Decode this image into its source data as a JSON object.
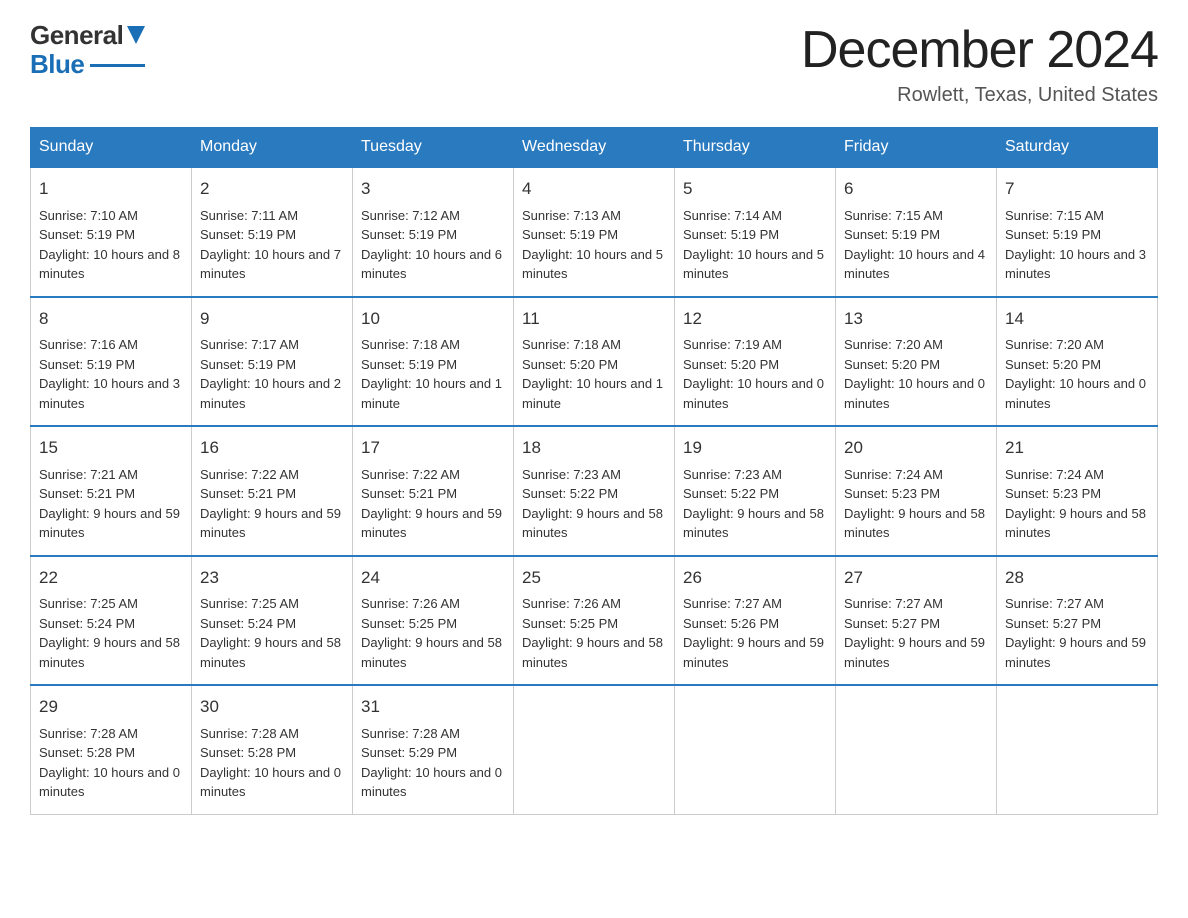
{
  "header": {
    "logo_general": "General",
    "logo_blue": "Blue",
    "month_title": "December 2024",
    "location": "Rowlett, Texas, United States"
  },
  "days_of_week": [
    "Sunday",
    "Monday",
    "Tuesday",
    "Wednesday",
    "Thursday",
    "Friday",
    "Saturday"
  ],
  "weeks": [
    [
      {
        "day": "1",
        "sunrise": "7:10 AM",
        "sunset": "5:19 PM",
        "daylight": "10 hours and 8 minutes."
      },
      {
        "day": "2",
        "sunrise": "7:11 AM",
        "sunset": "5:19 PM",
        "daylight": "10 hours and 7 minutes."
      },
      {
        "day": "3",
        "sunrise": "7:12 AM",
        "sunset": "5:19 PM",
        "daylight": "10 hours and 6 minutes."
      },
      {
        "day": "4",
        "sunrise": "7:13 AM",
        "sunset": "5:19 PM",
        "daylight": "10 hours and 5 minutes."
      },
      {
        "day": "5",
        "sunrise": "7:14 AM",
        "sunset": "5:19 PM",
        "daylight": "10 hours and 5 minutes."
      },
      {
        "day": "6",
        "sunrise": "7:15 AM",
        "sunset": "5:19 PM",
        "daylight": "10 hours and 4 minutes."
      },
      {
        "day": "7",
        "sunrise": "7:15 AM",
        "sunset": "5:19 PM",
        "daylight": "10 hours and 3 minutes."
      }
    ],
    [
      {
        "day": "8",
        "sunrise": "7:16 AM",
        "sunset": "5:19 PM",
        "daylight": "10 hours and 3 minutes."
      },
      {
        "day": "9",
        "sunrise": "7:17 AM",
        "sunset": "5:19 PM",
        "daylight": "10 hours and 2 minutes."
      },
      {
        "day": "10",
        "sunrise": "7:18 AM",
        "sunset": "5:19 PM",
        "daylight": "10 hours and 1 minute."
      },
      {
        "day": "11",
        "sunrise": "7:18 AM",
        "sunset": "5:20 PM",
        "daylight": "10 hours and 1 minute."
      },
      {
        "day": "12",
        "sunrise": "7:19 AM",
        "sunset": "5:20 PM",
        "daylight": "10 hours and 0 minutes."
      },
      {
        "day": "13",
        "sunrise": "7:20 AM",
        "sunset": "5:20 PM",
        "daylight": "10 hours and 0 minutes."
      },
      {
        "day": "14",
        "sunrise": "7:20 AM",
        "sunset": "5:20 PM",
        "daylight": "10 hours and 0 minutes."
      }
    ],
    [
      {
        "day": "15",
        "sunrise": "7:21 AM",
        "sunset": "5:21 PM",
        "daylight": "9 hours and 59 minutes."
      },
      {
        "day": "16",
        "sunrise": "7:22 AM",
        "sunset": "5:21 PM",
        "daylight": "9 hours and 59 minutes."
      },
      {
        "day": "17",
        "sunrise": "7:22 AM",
        "sunset": "5:21 PM",
        "daylight": "9 hours and 59 minutes."
      },
      {
        "day": "18",
        "sunrise": "7:23 AM",
        "sunset": "5:22 PM",
        "daylight": "9 hours and 58 minutes."
      },
      {
        "day": "19",
        "sunrise": "7:23 AM",
        "sunset": "5:22 PM",
        "daylight": "9 hours and 58 minutes."
      },
      {
        "day": "20",
        "sunrise": "7:24 AM",
        "sunset": "5:23 PM",
        "daylight": "9 hours and 58 minutes."
      },
      {
        "day": "21",
        "sunrise": "7:24 AM",
        "sunset": "5:23 PM",
        "daylight": "9 hours and 58 minutes."
      }
    ],
    [
      {
        "day": "22",
        "sunrise": "7:25 AM",
        "sunset": "5:24 PM",
        "daylight": "9 hours and 58 minutes."
      },
      {
        "day": "23",
        "sunrise": "7:25 AM",
        "sunset": "5:24 PM",
        "daylight": "9 hours and 58 minutes."
      },
      {
        "day": "24",
        "sunrise": "7:26 AM",
        "sunset": "5:25 PM",
        "daylight": "9 hours and 58 minutes."
      },
      {
        "day": "25",
        "sunrise": "7:26 AM",
        "sunset": "5:25 PM",
        "daylight": "9 hours and 58 minutes."
      },
      {
        "day": "26",
        "sunrise": "7:27 AM",
        "sunset": "5:26 PM",
        "daylight": "9 hours and 59 minutes."
      },
      {
        "day": "27",
        "sunrise": "7:27 AM",
        "sunset": "5:27 PM",
        "daylight": "9 hours and 59 minutes."
      },
      {
        "day": "28",
        "sunrise": "7:27 AM",
        "sunset": "5:27 PM",
        "daylight": "9 hours and 59 minutes."
      }
    ],
    [
      {
        "day": "29",
        "sunrise": "7:28 AM",
        "sunset": "5:28 PM",
        "daylight": "10 hours and 0 minutes."
      },
      {
        "day": "30",
        "sunrise": "7:28 AM",
        "sunset": "5:28 PM",
        "daylight": "10 hours and 0 minutes."
      },
      {
        "day": "31",
        "sunrise": "7:28 AM",
        "sunset": "5:29 PM",
        "daylight": "10 hours and 0 minutes."
      },
      null,
      null,
      null,
      null
    ]
  ],
  "labels": {
    "sunrise": "Sunrise:",
    "sunset": "Sunset:",
    "daylight": "Daylight:"
  }
}
